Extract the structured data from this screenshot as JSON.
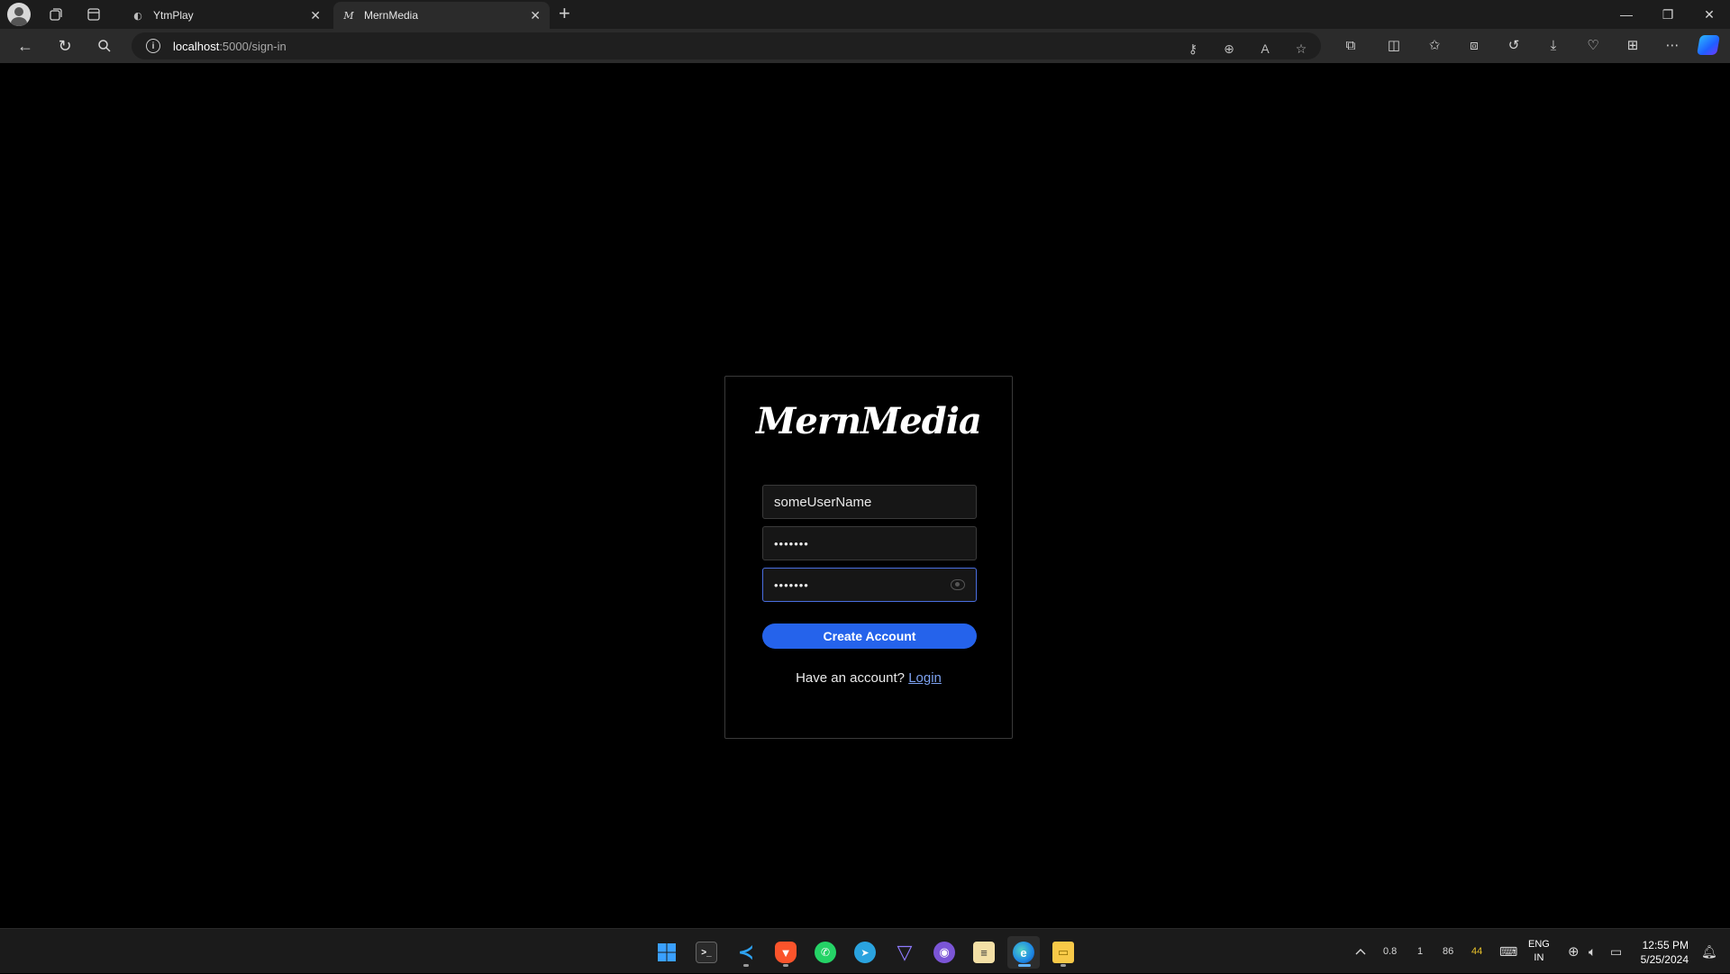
{
  "browser": {
    "tabs": [
      {
        "title": "YtmPlay",
        "favicon": "ytmplay-icon"
      },
      {
        "title": "MernMedia",
        "favicon": "mernmedia-m-icon",
        "active": true
      }
    ],
    "address": {
      "host": "localhost",
      "path": ":5000/sign-in"
    }
  },
  "page": {
    "logo": "MernMedia",
    "username_value": "someUserName",
    "password_value": "•••••••",
    "confirm_password_value": "•••••••",
    "create_button": "Create Account",
    "have_account_text": "Have an account?",
    "login_link": "Login"
  },
  "taskbar": {
    "apps": [
      "windows-start",
      "terminal",
      "vscode",
      "brave",
      "whatsapp",
      "telegram",
      "proton-vpn",
      "github-desktop",
      "notepad",
      "edge",
      "file-explorer"
    ],
    "tray_stats": [
      "0.8",
      "1",
      "86",
      "44"
    ],
    "lang_line1": "ENG",
    "lang_line2": "IN",
    "time": "12:55 PM",
    "date": "5/25/2024"
  },
  "colors": {
    "accent": "#2563eb",
    "link": "#7da2f0",
    "tray_highlight": "#e8c12a"
  }
}
